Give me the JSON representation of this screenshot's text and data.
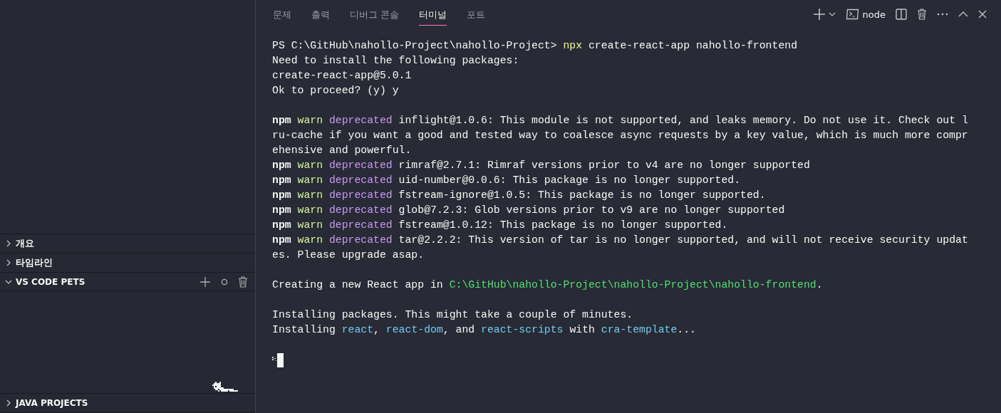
{
  "sidebar": {
    "sections": [
      {
        "title": "개요",
        "expanded": false,
        "kind": "plain"
      },
      {
        "title": "타임라인",
        "expanded": false,
        "kind": "plain"
      },
      {
        "title": "VS CODE PETS",
        "expanded": true,
        "kind": "pets"
      },
      {
        "title": "JAVA PROJECTS",
        "expanded": false,
        "kind": "plain"
      }
    ]
  },
  "panel": {
    "tabs": [
      {
        "label": "문제",
        "selected": false
      },
      {
        "label": "출력",
        "selected": false
      },
      {
        "label": "디버그 콘솔",
        "selected": false
      },
      {
        "label": "터미널",
        "selected": true
      },
      {
        "label": "포트",
        "selected": false
      }
    ],
    "terminal_name": "node",
    "lines": [
      {
        "kind": "text",
        "segments": [
          {
            "kind": "plain",
            "text": "PS C:\\GitHub\\nahollo-Project\\nahollo-Project> "
          },
          {
            "kind": "command",
            "text": "npx"
          },
          {
            "kind": "plain",
            "text": " create-react-app nahollo-frontend"
          }
        ]
      },
      {
        "kind": "text",
        "segments": [
          {
            "kind": "plain",
            "text": "Need to install the following packages:"
          }
        ]
      },
      {
        "kind": "text",
        "segments": [
          {
            "kind": "plain",
            "text": "create-react-app@5.0.1"
          }
        ]
      },
      {
        "kind": "text",
        "segments": [
          {
            "kind": "plain",
            "text": "Ok to proceed? (y) y"
          }
        ]
      },
      {
        "kind": "blank"
      },
      {
        "kind": "text",
        "segments": [
          {
            "kind": "npm",
            "text": "npm"
          },
          {
            "kind": "warn",
            "text": " warn"
          },
          {
            "kind": "deprecated",
            "text": " deprecated"
          },
          {
            "kind": "plain",
            "text": " inflight@1.0.6: This module is not supported, and leaks memory. Do not use it. Check out l"
          }
        ]
      },
      {
        "kind": "text",
        "segments": [
          {
            "kind": "plain",
            "text": "ru-cache if you want a good and tested way to coalesce async requests by a key value, which is much more compr"
          }
        ]
      },
      {
        "kind": "text",
        "segments": [
          {
            "kind": "plain",
            "text": "ehensive and powerful."
          }
        ]
      },
      {
        "kind": "text",
        "segments": [
          {
            "kind": "npm",
            "text": "npm"
          },
          {
            "kind": "warn",
            "text": " warn"
          },
          {
            "kind": "deprecated",
            "text": " deprecated"
          },
          {
            "kind": "plain",
            "text": " rimraf@2.7.1: Rimraf versions prior to v4 are no longer supported"
          }
        ]
      },
      {
        "kind": "text",
        "segments": [
          {
            "kind": "npm",
            "text": "npm"
          },
          {
            "kind": "warn",
            "text": " warn"
          },
          {
            "kind": "deprecated",
            "text": " deprecated"
          },
          {
            "kind": "plain",
            "text": " uid-number@0.0.6: This package is no longer supported."
          }
        ]
      },
      {
        "kind": "text",
        "segments": [
          {
            "kind": "npm",
            "text": "npm"
          },
          {
            "kind": "warn",
            "text": " warn"
          },
          {
            "kind": "deprecated",
            "text": " deprecated"
          },
          {
            "kind": "plain",
            "text": " fstream-ignore@1.0.5: This package is no longer supported."
          }
        ]
      },
      {
        "kind": "text",
        "segments": [
          {
            "kind": "npm",
            "text": "npm"
          },
          {
            "kind": "warn",
            "text": " warn"
          },
          {
            "kind": "deprecated",
            "text": " deprecated"
          },
          {
            "kind": "plain",
            "text": " glob@7.2.3: Glob versions prior to v9 are no longer supported"
          }
        ]
      },
      {
        "kind": "text",
        "segments": [
          {
            "kind": "npm",
            "text": "npm"
          },
          {
            "kind": "warn",
            "text": " warn"
          },
          {
            "kind": "deprecated",
            "text": " deprecated"
          },
          {
            "kind": "plain",
            "text": " fstream@1.0.12: This package is no longer supported."
          }
        ]
      },
      {
        "kind": "text",
        "segments": [
          {
            "kind": "npm",
            "text": "npm"
          },
          {
            "kind": "warn",
            "text": " warn"
          },
          {
            "kind": "deprecated",
            "text": " deprecated"
          },
          {
            "kind": "plain",
            "text": " tar@2.2.2: This version of tar is no longer supported, and will not receive security updat"
          }
        ]
      },
      {
        "kind": "text",
        "segments": [
          {
            "kind": "plain",
            "text": "es. Please upgrade asap."
          }
        ]
      },
      {
        "kind": "blank"
      },
      {
        "kind": "text",
        "segments": [
          {
            "kind": "plain",
            "text": "Creating a new React app in "
          },
          {
            "kind": "path",
            "text": "C:\\GitHub\\nahollo-Project\\nahollo-Project\\nahollo-frontend"
          },
          {
            "kind": "plain",
            "text": "."
          }
        ]
      },
      {
        "kind": "blank"
      },
      {
        "kind": "text",
        "segments": [
          {
            "kind": "plain",
            "text": "Installing packages. This might take a couple of minutes."
          }
        ]
      },
      {
        "kind": "text",
        "segments": [
          {
            "kind": "plain",
            "text": "Installing "
          },
          {
            "kind": "package",
            "text": "react"
          },
          {
            "kind": "plain",
            "text": ", "
          },
          {
            "kind": "package",
            "text": "react-dom"
          },
          {
            "kind": "plain",
            "text": ", and "
          },
          {
            "kind": "package",
            "text": "react-scripts"
          },
          {
            "kind": "plain",
            "text": " with "
          },
          {
            "kind": "package",
            "text": "cra-template"
          },
          {
            "kind": "plain",
            "text": "..."
          }
        ]
      },
      {
        "kind": "blank"
      },
      {
        "kind": "spinner"
      }
    ]
  }
}
